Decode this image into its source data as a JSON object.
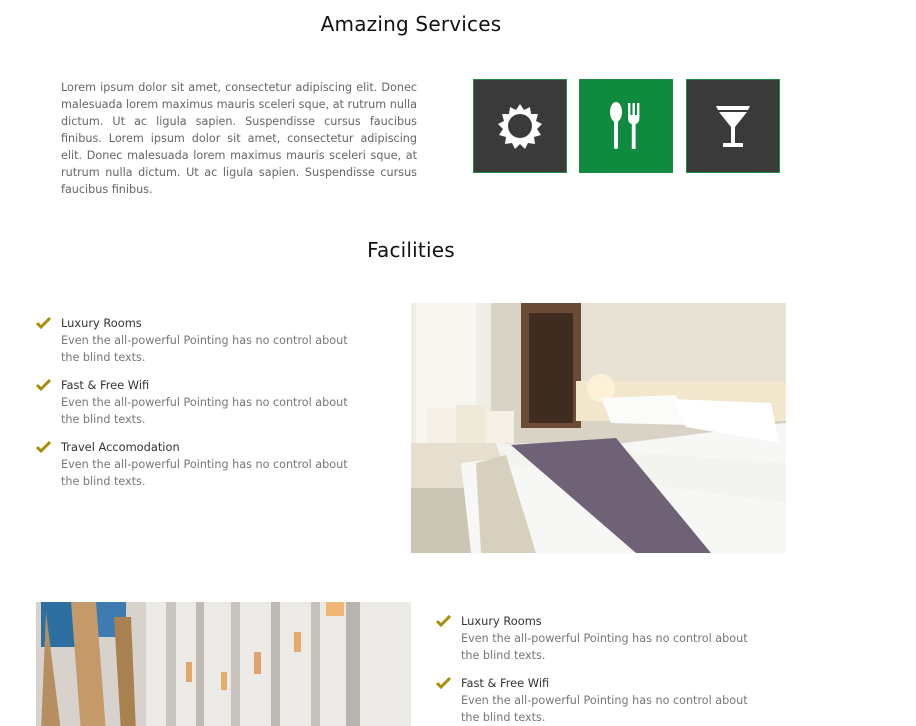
{
  "services": {
    "title": "Amazing Services",
    "description": "Lorem ipsum dolor sit amet, consectetur adipiscing elit. Donec malesuada lorem maximus mauris sceleri sque, at rutrum nulla dictum. Ut ac ligula sapien. Suspendisse cursus faucibus finibus. Lorem ipsum dolor sit amet, consectetur adipiscing elit. Donec malesuada lorem maximus mauris sceleri sque, at rutrum nulla dictum. Ut ac ligula sapien. Suspendisse cursus faucibus finibus.",
    "icons": [
      {
        "icon": "sun-icon",
        "active": false
      },
      {
        "icon": "spoon-fork-icon",
        "active": true
      },
      {
        "icon": "cocktail-glass-icon",
        "active": false
      }
    ]
  },
  "facilities": {
    "title": "Facilities",
    "block1": [
      {
        "title": "Luxury Rooms",
        "desc": "Even the all-powerful Pointing has no control about the blind texts."
      },
      {
        "title": "Fast & Free Wifi",
        "desc": "Even the all-powerful Pointing has no control about the blind texts."
      },
      {
        "title": "Travel Accomodation",
        "desc": "Even the all-powerful Pointing has no control about the blind texts."
      }
    ],
    "block2": [
      {
        "title": "Luxury Rooms",
        "desc": "Even the all-powerful Pointing has no control about the blind texts."
      },
      {
        "title": "Fast & Free Wifi",
        "desc": "Even the all-powerful Pointing has no control about the blind texts."
      }
    ]
  },
  "colors": {
    "accent_green": "#0f8a3e",
    "tile_dark": "#3a3a3a",
    "check_gold": "#a8900f"
  }
}
